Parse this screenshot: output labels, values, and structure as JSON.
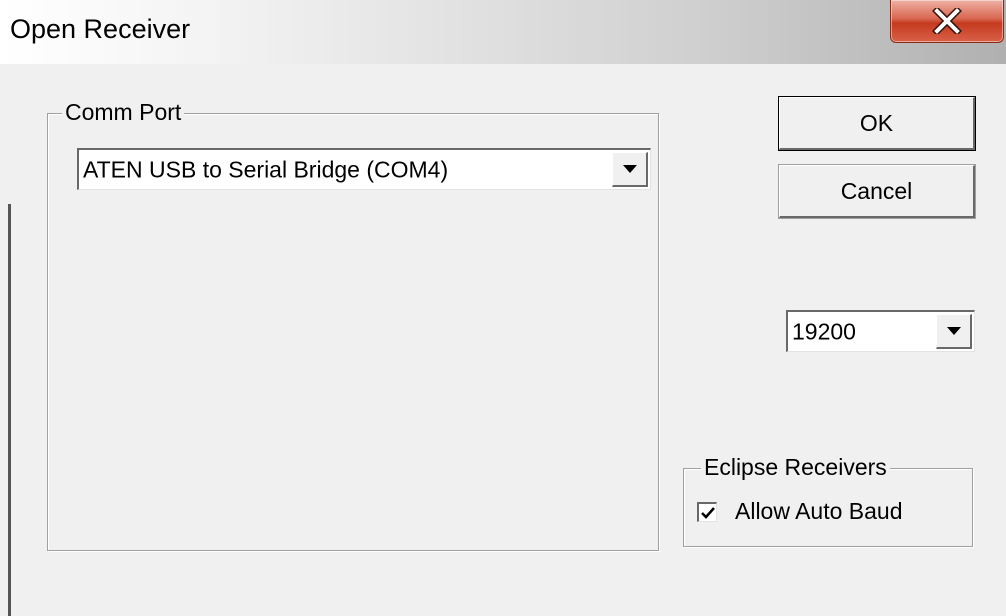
{
  "window": {
    "title": "Open Receiver",
    "close_icon": "close-icon"
  },
  "comm_port": {
    "legend": "Comm Port",
    "selected": "ATEN USB to Serial Bridge (COM4)"
  },
  "buttons": {
    "ok_label": "OK",
    "cancel_label": "Cancel"
  },
  "baud": {
    "selected": "19200"
  },
  "eclipse": {
    "legend": "Eclipse Receivers",
    "auto_baud_label": "Allow Auto Baud",
    "auto_baud_checked": true
  },
  "colors": {
    "close_button": "#c43a1f",
    "dialog_background": "#f0f0f0"
  }
}
